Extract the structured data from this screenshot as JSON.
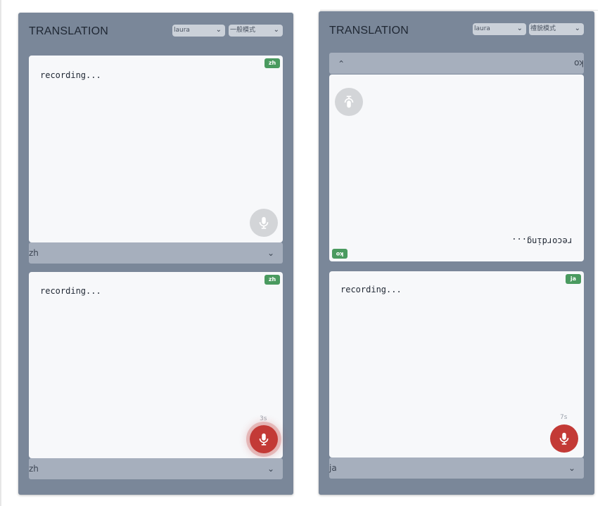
{
  "left_panel": {
    "title": "TRANSLATION",
    "voice_select": "laura",
    "mode_select": "一般模式",
    "top_card": {
      "text": "recording...",
      "badge": "zh"
    },
    "top_lang": "zh",
    "bottom_card": {
      "text": "recording...",
      "badge": "zh",
      "timer": "3s"
    },
    "bottom_lang": "zh"
  },
  "right_panel": {
    "title": "TRANSLATION",
    "voice_select": "laura",
    "mode_select": "禮貌模式",
    "top_lang": "ko",
    "top_card": {
      "text": "recording...",
      "badge": "ko"
    },
    "bottom_card": {
      "text": "recording...",
      "badge": "ja",
      "timer": "7s"
    },
    "bottom_lang": "ja"
  },
  "colors": {
    "panel": "#7a8799",
    "mic_active": "#c33a36",
    "badge": "#4a9a5f"
  }
}
